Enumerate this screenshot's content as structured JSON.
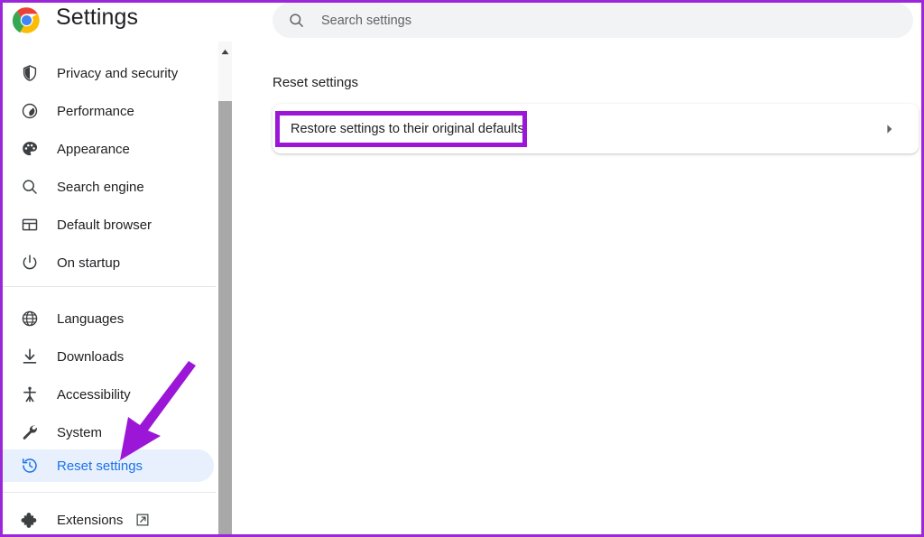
{
  "header": {
    "logo_icon": "chrome-logo-icon",
    "title": "Settings"
  },
  "search": {
    "icon": "search-icon",
    "placeholder": "Search settings",
    "value": ""
  },
  "sidebar": {
    "groups": [
      {
        "items": [
          {
            "label": "Privacy and security",
            "icon": "shield-icon",
            "selected": false
          },
          {
            "label": "Performance",
            "icon": "speedometer-icon",
            "selected": false
          },
          {
            "label": "Appearance",
            "icon": "palette-icon",
            "selected": false
          },
          {
            "label": "Search engine",
            "icon": "magnifier-icon",
            "selected": false
          },
          {
            "label": "Default browser",
            "icon": "browser-window-icon",
            "selected": false
          },
          {
            "label": "On startup",
            "icon": "power-icon",
            "selected": false
          }
        ]
      },
      {
        "items": [
          {
            "label": "Languages",
            "icon": "globe-icon",
            "selected": false
          },
          {
            "label": "Downloads",
            "icon": "download-icon",
            "selected": false
          },
          {
            "label": "Accessibility",
            "icon": "accessibility-person-icon",
            "selected": false
          },
          {
            "label": "System",
            "icon": "wrench-icon",
            "selected": false
          },
          {
            "label": "Reset settings",
            "icon": "history-restore-icon",
            "selected": true
          }
        ]
      },
      {
        "items": [
          {
            "label": "Extensions",
            "icon": "puzzle-piece-icon",
            "selected": false,
            "external_icon": "external-link-icon"
          }
        ]
      }
    ]
  },
  "main": {
    "section_heading": "Reset settings",
    "card": {
      "label": "Restore settings to their original defaults",
      "chevron_icon": "chevron-right-icon"
    }
  },
  "scrollbar": {
    "up_arrow_icon": "scroll-up-arrow-icon",
    "thumb": "scrollbar-thumb"
  },
  "annotations": {
    "highlight_color": "#9c16d8",
    "arrow_color": "#9c16d8",
    "frame_color": "#9c27d8"
  }
}
